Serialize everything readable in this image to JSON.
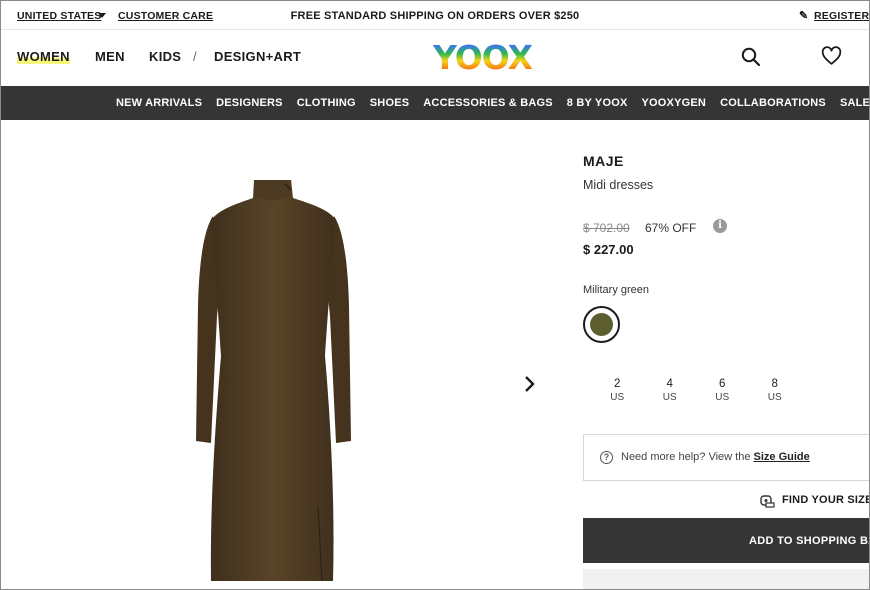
{
  "utility_bar": {
    "country": "UNITED STATES",
    "customer_care": "CUSTOMER CARE",
    "shipping_banner": "FREE STANDARD SHIPPING ON ORDERS OVER $250",
    "register": "REGISTER"
  },
  "main_nav": {
    "items": [
      "WOMEN",
      "MEN",
      "KIDS",
      "/",
      "DESIGN+ART"
    ],
    "active": "WOMEN",
    "logo": "YOOX"
  },
  "category_nav": [
    "NEW ARRIVALS",
    "DESIGNERS",
    "CLOTHING",
    "SHOES",
    "ACCESSORIES & BAGS",
    "8 BY YOOX",
    "YOOXYGEN",
    "COLLABORATIONS",
    "SALE"
  ],
  "product": {
    "brand": "MAJE",
    "category": "Midi dresses",
    "original_price": "$ 702.00",
    "discount": "67% OFF",
    "price": "$ 227.00",
    "color_name": "Military green",
    "swatch_color": "#5d5e30",
    "sizes": [
      {
        "num": "2",
        "unit": "US"
      },
      {
        "num": "4",
        "unit": "US"
      },
      {
        "num": "6",
        "unit": "US"
      },
      {
        "num": "8",
        "unit": "US"
      }
    ]
  },
  "help": {
    "text": "Need more help? View the ",
    "link": "Size Guide"
  },
  "find_your_size": "FIND YOUR SIZE",
  "add_to_bag": "ADD TO SHOPPING BAG",
  "colors": {
    "dark_bar": "#353535",
    "dress_brown": "#4a3720"
  }
}
